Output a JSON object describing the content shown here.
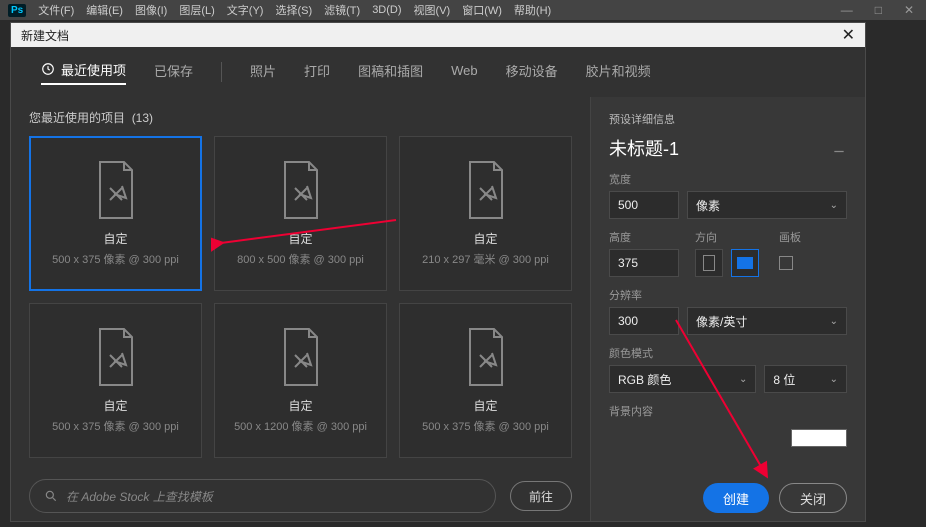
{
  "app": {
    "logo": "Ps"
  },
  "menubar": [
    "文件(F)",
    "编辑(E)",
    "图像(I)",
    "图层(L)",
    "文字(Y)",
    "选择(S)",
    "滤镜(T)",
    "3D(D)",
    "视图(V)",
    "窗口(W)",
    "帮助(H)"
  ],
  "dialog": {
    "title": "新建文档",
    "tabs": [
      "最近使用项",
      "已保存",
      "照片",
      "打印",
      "图稿和插图",
      "Web",
      "移动设备",
      "胶片和视频"
    ],
    "active_tab": 0,
    "recent_label": "您最近使用的项目",
    "recent_count": "(13)",
    "presets": [
      {
        "name": "自定",
        "meta": "500 x 375 像素 @ 300 ppi",
        "selected": true
      },
      {
        "name": "自定",
        "meta": "800 x 500 像素 @ 300 ppi"
      },
      {
        "name": "自定",
        "meta": "210 x 297 毫米 @ 300 ppi"
      },
      {
        "name": "自定",
        "meta": "500 x 375 像素 @ 300 ppi"
      },
      {
        "name": "自定",
        "meta": "500 x 1200 像素 @ 300 ppi"
      },
      {
        "name": "自定",
        "meta": "500 x 375 像素 @ 300 ppi"
      }
    ],
    "stock_placeholder": "在 Adobe Stock 上查找模板",
    "stock_go": "前往"
  },
  "panel": {
    "heading": "预设详细信息",
    "doc_title": "未标题-1",
    "width_label": "宽度",
    "width_value": "500",
    "width_unit": "像素",
    "height_label": "高度",
    "orient_label": "方向",
    "artboard_label": "画板",
    "height_value": "375",
    "res_label": "分辨率",
    "res_value": "300",
    "res_unit": "像素/英寸",
    "color_label": "颜色模式",
    "color_mode": "RGB 颜色",
    "bit_depth": "8 位",
    "bg_label": "背景内容",
    "create": "创建",
    "close": "关闭"
  }
}
